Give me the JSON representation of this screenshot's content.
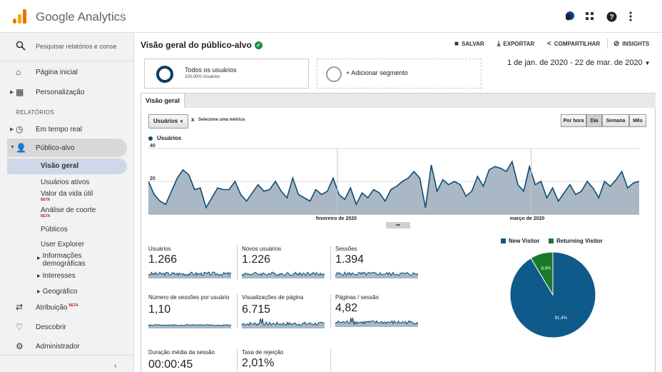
{
  "app": {
    "title": "Google Analytics"
  },
  "topbar": {
    "icons": [
      "notifications-icon",
      "apps-grid-icon",
      "help-icon",
      "more-vert-icon"
    ]
  },
  "sidebar": {
    "search_placeholder": "Pesquisar relatórios e conse",
    "home": "Página inicial",
    "custom": "Personalização",
    "reports_header": "RELATÓRIOS",
    "realtime": "Em tempo real",
    "audience": "Público-alvo",
    "audience_items": {
      "overview": "Visão geral",
      "active_users": "Usuários ativos",
      "lifetime_value": "Valor da vida útil",
      "cohort": "Análise de coorte",
      "audiences": "Públicos",
      "user_explorer": "User Explorer",
      "demographics": "Informações demográficas",
      "interests": "Interesses",
      "geo": "Geográfico"
    },
    "beta": "BETA",
    "attribution": "Atribuição",
    "discover": "Descobrir",
    "admin": "Administrador",
    "collapse": "‹"
  },
  "main": {
    "title": "Visão geral do público-alvo",
    "actions": {
      "save": "SALVAR",
      "export": "EXPORTAR",
      "share": "COMPARTILHAR",
      "insights": "INSIGHTS"
    },
    "segment1": {
      "name": "Todos os usuários",
      "sub": "100,00% Usuários"
    },
    "segment2": {
      "name": "+ Adicionar segmento"
    },
    "date_range": "1 de jan. de 2020 - 22 de mar. de 2020",
    "tab": "Visão geral",
    "metric_select": "Usuários",
    "metric_remove": "x",
    "metric_pick": "Selecione uma métrica",
    "granularity": [
      "Por hora",
      "Dia",
      "Semana",
      "Mês"
    ],
    "granularity_active": "Dia",
    "legend": "Usuários"
  },
  "chart_data": [
    {
      "type": "area",
      "series": [
        {
          "name": "Usuários",
          "color": "#0e4c73",
          "values": [
            20,
            12,
            8,
            6,
            14,
            22,
            27,
            24,
            15,
            16,
            4,
            10,
            16,
            15,
            15,
            20,
            12,
            8,
            13,
            18,
            14,
            15,
            20,
            14,
            10,
            22,
            12,
            10,
            8,
            15,
            12,
            14,
            22,
            12,
            9,
            16,
            6,
            13,
            10,
            15,
            13,
            8,
            15,
            17,
            20,
            22,
            26,
            22,
            4,
            30,
            14,
            21,
            18,
            20,
            18,
            11,
            14,
            23,
            17,
            27,
            29,
            28,
            26,
            32,
            18,
            14,
            29,
            18,
            20,
            10,
            16,
            8,
            13,
            18,
            12,
            14,
            20,
            16,
            10,
            20,
            17,
            21,
            26,
            16,
            19,
            20
          ]
        }
      ],
      "ylabels": [
        "40",
        "20"
      ],
      "ylim": [
        0,
        40
      ],
      "xlabels": [
        "fevereiro de 2020",
        "março de 2020"
      ]
    },
    {
      "type": "pie",
      "series": [
        {
          "name": "New Visitor",
          "value": 91.4,
          "label": "91,4%",
          "color": "#0e5a8a"
        },
        {
          "name": "Returning Visitor",
          "value": 8.6,
          "label": "8,6%",
          "color": "#1a7a2a"
        }
      ]
    }
  ],
  "kpis": [
    {
      "label": "Usuários",
      "value": "1.266"
    },
    {
      "label": "Novos usuários",
      "value": "1.226"
    },
    {
      "label": "Sessões",
      "value": "1.394"
    },
    {
      "label": "Número de sessões por usuário",
      "value": "1,10"
    },
    {
      "label": "Visualizações de página",
      "value": "6.715"
    },
    {
      "label": "Páginas / sessão",
      "value": "4,82"
    },
    {
      "label": "Duração média da sessão",
      "value": "00:00:45"
    },
    {
      "label": "Taxa de rejeição",
      "value": "2,01%"
    }
  ],
  "colors": {
    "accent": "#0e4c73",
    "green": "#1e8e3e",
    "area_fill": "#a9b8c4"
  }
}
